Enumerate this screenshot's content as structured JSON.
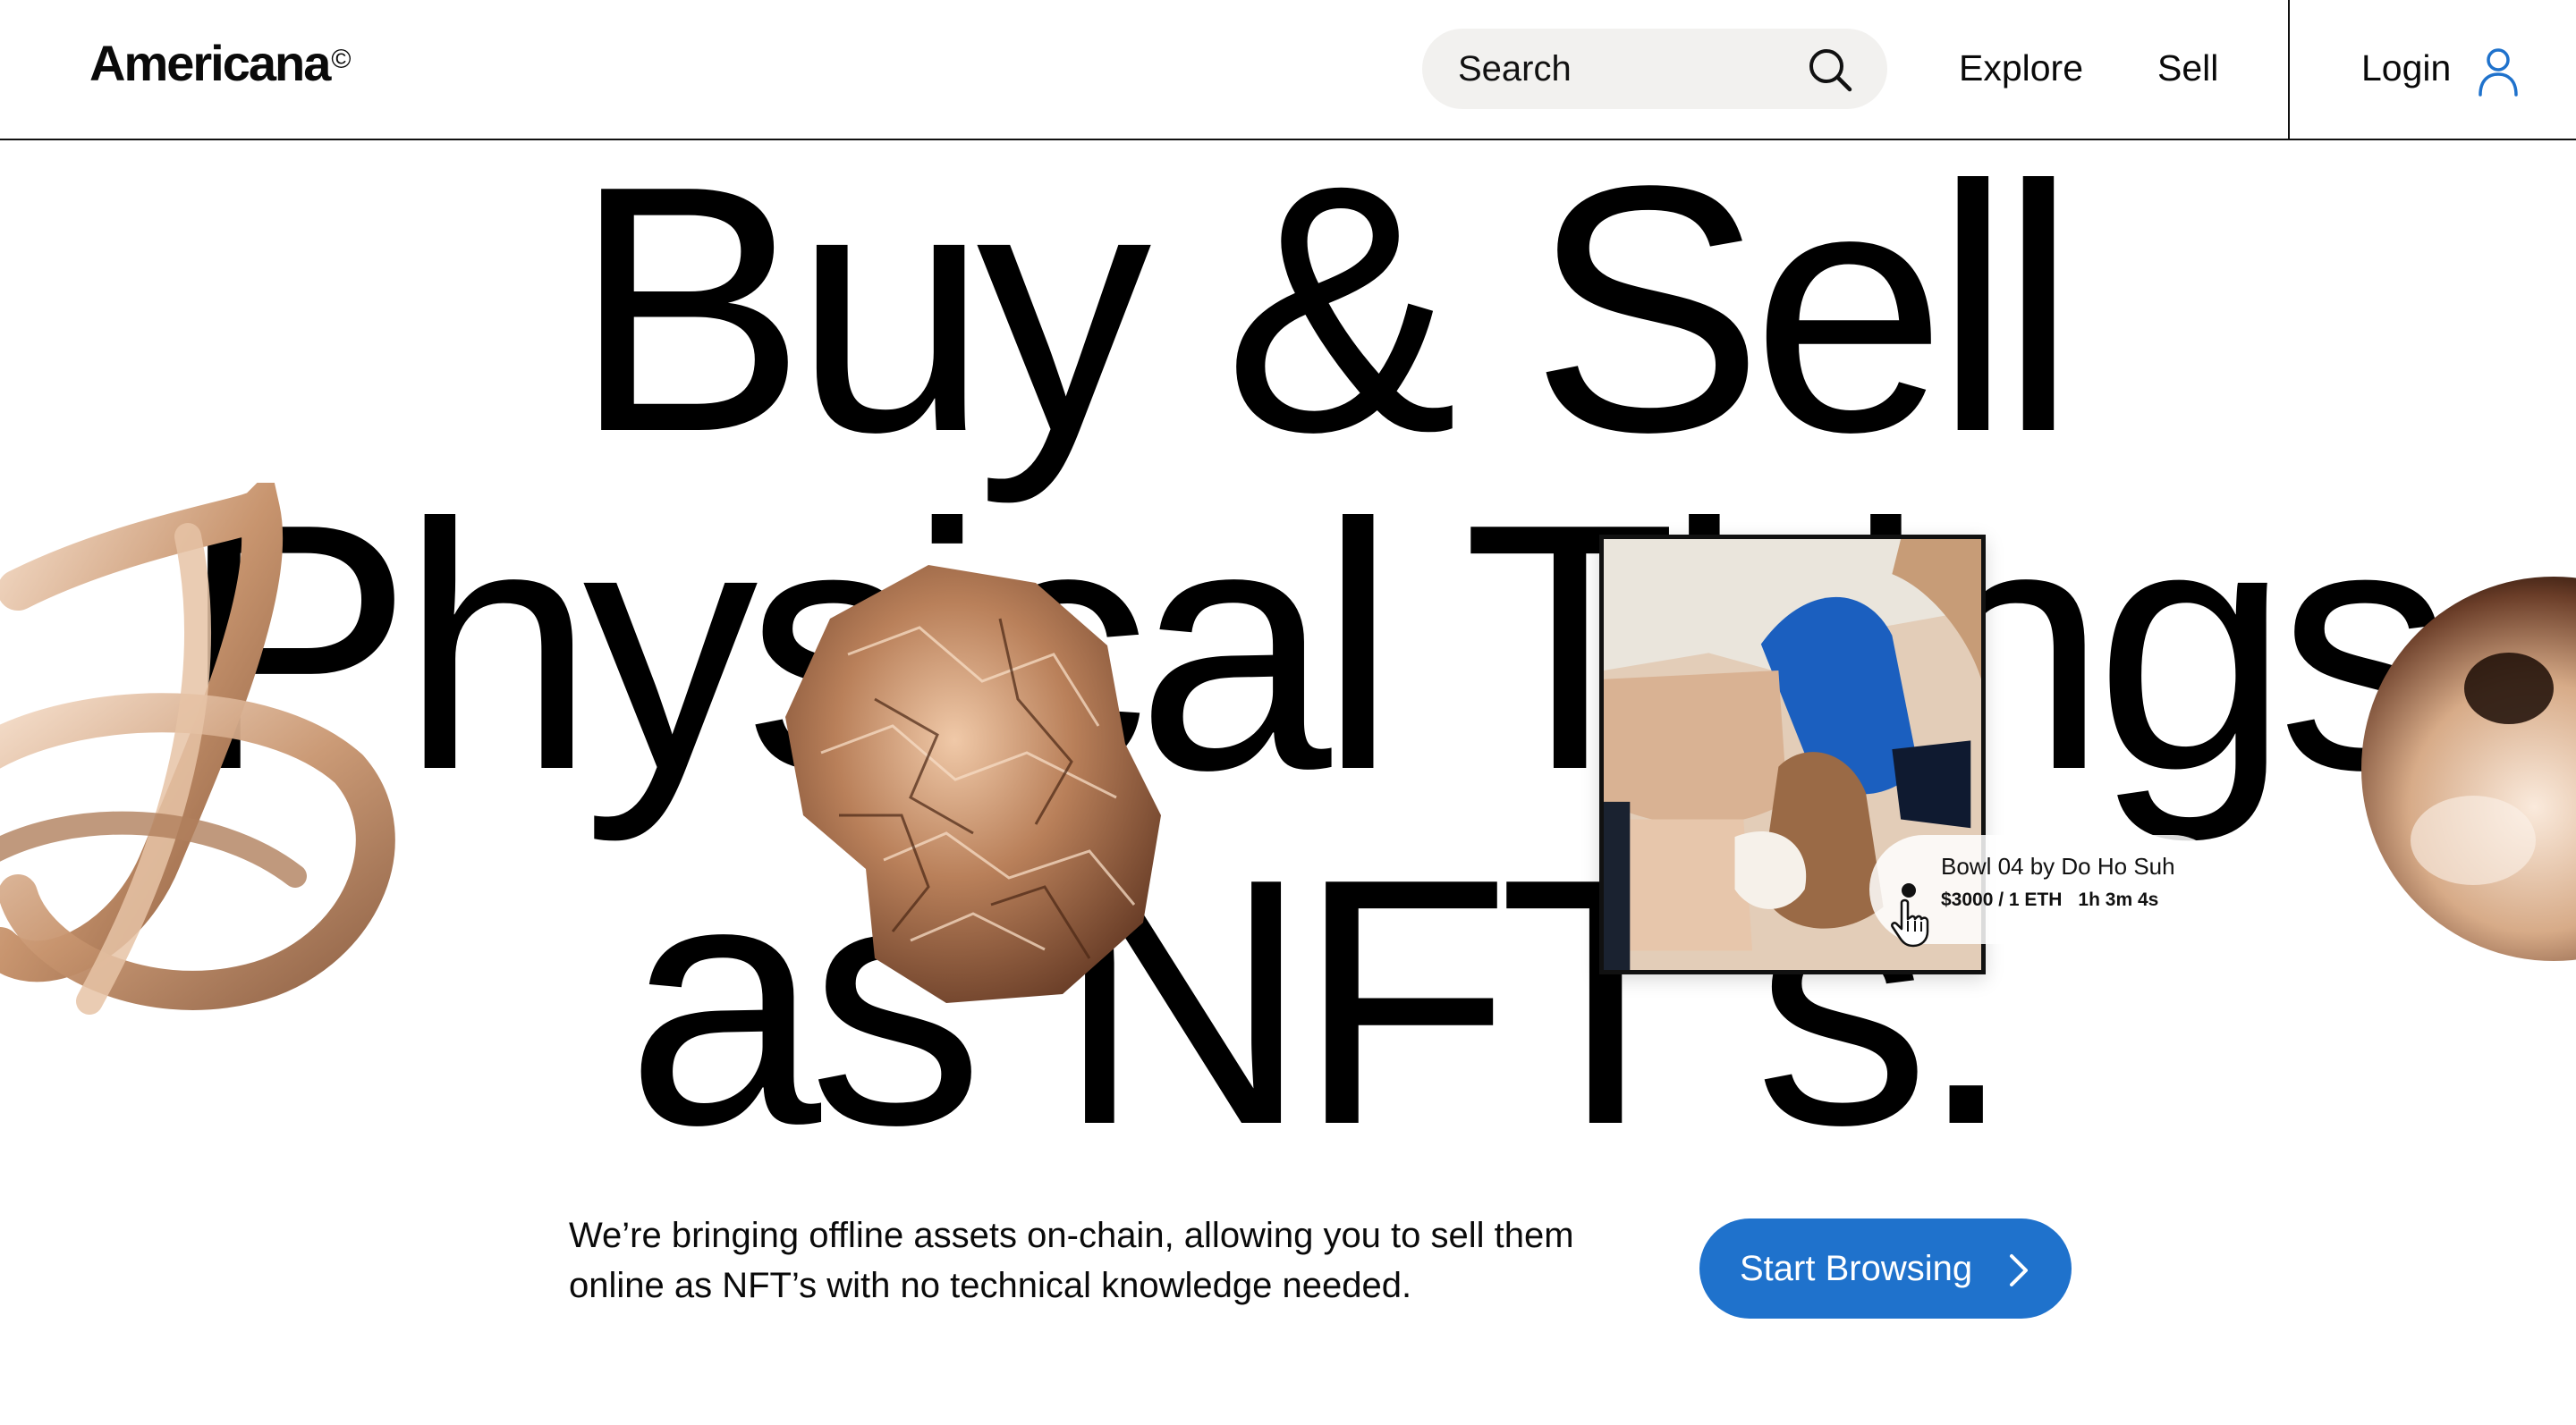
{
  "header": {
    "logo": "Americana",
    "logo_mark": "©",
    "search_placeholder": "Search",
    "nav": {
      "explore": "Explore",
      "sell": "Sell",
      "login": "Login"
    }
  },
  "hero": {
    "line1": "Buy & Sell",
    "line2": "Physical Things",
    "line3": "as NFT's."
  },
  "artwork": {
    "title": "Bowl 04 by Do Ho Suh",
    "price": "$3000 / 1 ETH",
    "time_left": "1h 3m 4s"
  },
  "intro": {
    "text": "We’re bringing offline assets on-chain, allowing you to sell them online as NFT’s with no technical knowledge needed."
  },
  "cta": {
    "label": "Start Browsing"
  },
  "colors": {
    "accent": "#1f72cc",
    "text": "#0a0a0a",
    "search_bg": "#f2f1ef",
    "copper": "#c99a78"
  },
  "icons": {
    "search": "search-icon",
    "user": "user-icon",
    "chevron": "chevron-right-icon",
    "cursor": "hand-cursor-icon"
  }
}
